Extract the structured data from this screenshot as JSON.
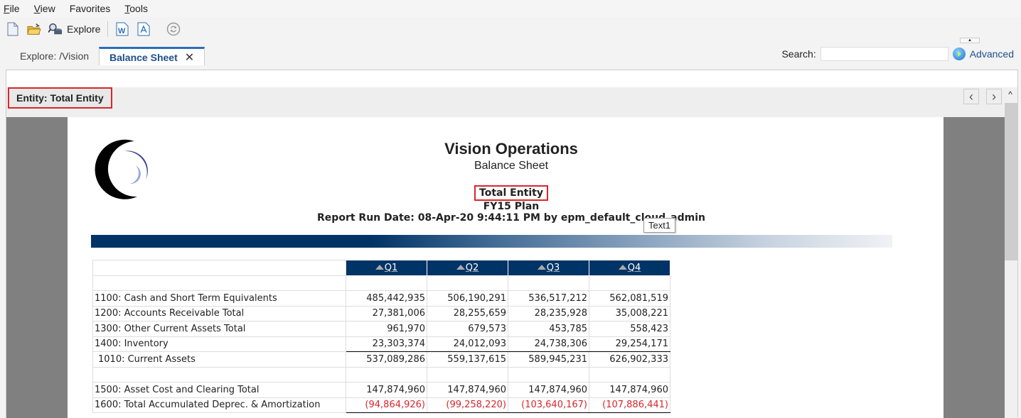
{
  "menu": {
    "items": [
      {
        "label": "File",
        "mnemonic": "F",
        "rest": "ile"
      },
      {
        "label": "View",
        "mnemonic": "V",
        "rest": "iew"
      },
      {
        "label": "Favorites",
        "mnemonic": "",
        "rest": "Favorites"
      },
      {
        "label": "Tools",
        "mnemonic": "T",
        "rest": "ools"
      }
    ]
  },
  "toolbar": {
    "explore_label": "Explore"
  },
  "tabs": [
    {
      "label": "Explore: /Vision",
      "active": false
    },
    {
      "label": "Balance Sheet",
      "active": true
    }
  ],
  "tab_close_glyph": "✕",
  "search": {
    "label": "Search:",
    "value": "",
    "advanced_label": "Advanced"
  },
  "pov": {
    "label": "Entity: Total Entity"
  },
  "report": {
    "title": "Vision Operations",
    "subtitle": "Balance Sheet",
    "entity": "Total Entity",
    "scenario": "FY15 Plan",
    "run_date": "Report Run Date: 08-Apr-20 9:44:11 PM by epm_default_cloud_admin",
    "tooltip": "Text1",
    "columns": [
      "Q1",
      "Q2",
      "Q3",
      "Q4"
    ],
    "rows": [
      {
        "label": "",
        "values": [
          "",
          "",
          "",
          ""
        ],
        "type": "blank"
      },
      {
        "label": "1100: Cash and Short Term Equivalents",
        "values": [
          "485,442,935",
          "506,190,291",
          "536,517,212",
          "562,081,519"
        ]
      },
      {
        "label": "1200: Accounts Receivable Total",
        "values": [
          "27,381,006",
          "28,255,659",
          "28,235,928",
          "35,008,221"
        ]
      },
      {
        "label": "1300: Other Current Assets Total",
        "values": [
          "961,970",
          "679,573",
          "453,785",
          "558,423"
        ]
      },
      {
        "label": "1400: Inventory",
        "values": [
          "23,303,374",
          "24,012,093",
          "24,738,306",
          "29,254,171"
        ],
        "underline": true
      },
      {
        "label": "1010: Current Assets",
        "values": [
          "537,089,286",
          "559,137,615",
          "589,945,231",
          "626,902,333"
        ],
        "type": "total"
      },
      {
        "label": "",
        "values": [
          "",
          "",
          "",
          ""
        ],
        "type": "blank"
      },
      {
        "label": "1500: Asset Cost and Clearing Total",
        "values": [
          "147,874,960",
          "147,874,960",
          "147,874,960",
          "147,874,960"
        ]
      },
      {
        "label": "1600: Total Accumulated Deprec. & Amortization",
        "values": [
          "(94,864,926)",
          "(99,258,220)",
          "(103,640,167)",
          "(107,886,441)"
        ],
        "negative": true,
        "underline": true
      }
    ]
  },
  "colors": {
    "accent_blue": "#003366",
    "highlight_red": "#d9262c",
    "tab_blue": "#1f4e8c"
  }
}
